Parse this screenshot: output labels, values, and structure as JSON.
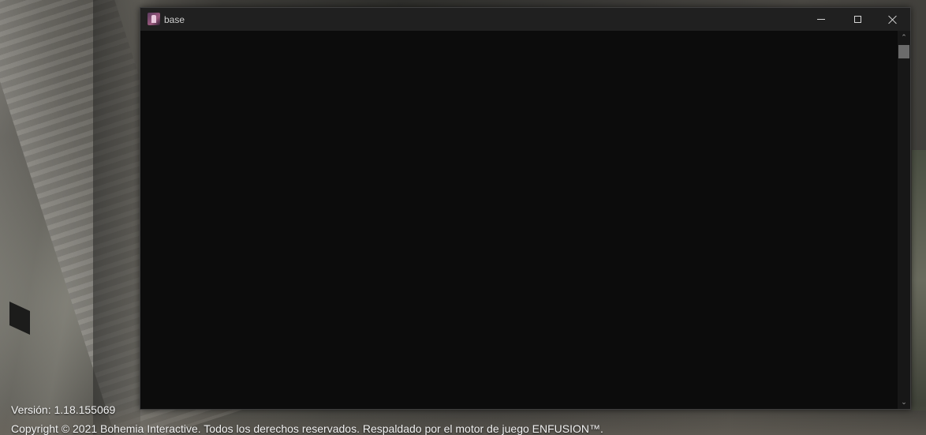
{
  "window": {
    "title": "base",
    "app_icon": "app-logo-icon",
    "controls": {
      "minimize_icon": "minimize-icon",
      "maximize_icon": "maximize-icon",
      "close_icon": "close-icon"
    },
    "console_output": "",
    "scrollbar": {
      "up_glyph": "⌃",
      "down_glyph": "⌄"
    }
  },
  "footer": {
    "version": "Versión: 1.18.155069",
    "copyright": "Copyright © 2021 Bohemia Interactive. Todos los derechos reservados. Respaldado por el motor de juego ENFUSION™."
  },
  "colors": {
    "console_background": "#0c0c0c",
    "title_bar": "#202020",
    "title_text": "#cfcfcf",
    "footer_text": "#f2f2f2"
  }
}
